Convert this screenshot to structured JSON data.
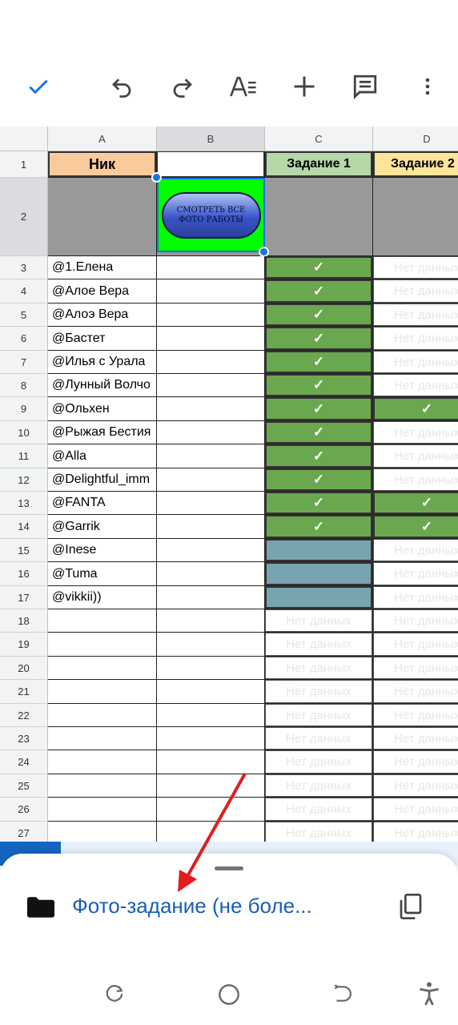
{
  "toolbar": {
    "icons": [
      "check-icon",
      "undo-icon",
      "redo-icon",
      "text-format-icon",
      "add-icon",
      "comment-icon",
      "more-icon"
    ]
  },
  "sheet": {
    "columns": [
      "A",
      "B",
      "C",
      "D"
    ],
    "header_row": {
      "a": "Ник",
      "c": "Задание 1",
      "d": "Задание 2"
    },
    "button_image_text": [
      "СМОТРЕТЬ ВСЕ",
      "ФОТО РАБОТЫ"
    ],
    "row_numbers": [
      "1",
      "2",
      "3",
      "4",
      "5",
      "6",
      "7",
      "8",
      "9",
      "10",
      "11",
      "12",
      "13",
      "14",
      "15",
      "16",
      "17",
      "18",
      "19",
      "20",
      "21",
      "22",
      "23",
      "24",
      "25",
      "26",
      "27"
    ],
    "rows": [
      {
        "a": "@1.Елена",
        "c": "check",
        "d": "Нет данных"
      },
      {
        "a": "@Алое Вера",
        "c": "check",
        "d": "Нет данных"
      },
      {
        "a": "@Алоэ Вера",
        "c": "check",
        "d": "Нет данных"
      },
      {
        "a": "@Бастет",
        "c": "check",
        "d": "Нет данных"
      },
      {
        "a": "@Илья с Урала",
        "c": "check",
        "d": "Нет данных"
      },
      {
        "a": "@Лунный Волчо",
        "c": "check",
        "d": "Нет данных"
      },
      {
        "a": "@Ольхен",
        "c": "check",
        "d": "check"
      },
      {
        "a": "@Рыжая Бестия",
        "c": "check",
        "d": "Нет данных"
      },
      {
        "a": "@Alla",
        "c": "check",
        "d": "Нет данных"
      },
      {
        "a": "@Delightful_imm",
        "c": "check",
        "d": "Нет данных"
      },
      {
        "a": "@FANTA",
        "c": "check",
        "d": "check"
      },
      {
        "a": "@Garrik",
        "c": "check",
        "d": "check"
      },
      {
        "a": "@Inese",
        "c": "empty",
        "d": "Нет данных"
      },
      {
        "a": "@Tuma",
        "c": "empty",
        "d": "Нет данных"
      },
      {
        "a": "@vikkii))",
        "c": "empty",
        "d": "Нет данных"
      },
      {
        "a": "",
        "c": "Нет данных",
        "d": "Нет данных"
      },
      {
        "a": "",
        "c": "Нет данных",
        "d": "Нет данных"
      },
      {
        "a": "",
        "c": "Нет данных",
        "d": "Нет данных"
      },
      {
        "a": "",
        "c": "Нет данных",
        "d": "Нет данных"
      },
      {
        "a": "",
        "c": "Нет данных",
        "d": "Нет данных"
      },
      {
        "a": "",
        "c": "Нет данных",
        "d": "Нет данных"
      },
      {
        "a": "",
        "c": "Нет данных",
        "d": "Нет данных"
      },
      {
        "a": "",
        "c": "Нет данных",
        "d": "Нет данных"
      },
      {
        "a": "",
        "c": "Нет данных",
        "d": "Нет данных"
      },
      {
        "a": "",
        "c": "Нет данных",
        "d": "Нет данных"
      }
    ],
    "check_mark": "✓",
    "colors": {
      "header_a": "#f9cb9c",
      "header_c": "#b6d7a8",
      "header_d": "#ffe599",
      "done": "#6aa84f",
      "pending": "#76a5af",
      "row2_fill": "#999999",
      "image_bg": "#00ff00",
      "selection": "#1a73e8"
    }
  },
  "bottom_sheet": {
    "title": "Фото-задание (не боле...",
    "icons": [
      "folder-icon",
      "copy-icon"
    ]
  },
  "nav_bar": {
    "icons": [
      "recents-icon",
      "home-icon",
      "back-icon",
      "accessibility-icon"
    ]
  }
}
